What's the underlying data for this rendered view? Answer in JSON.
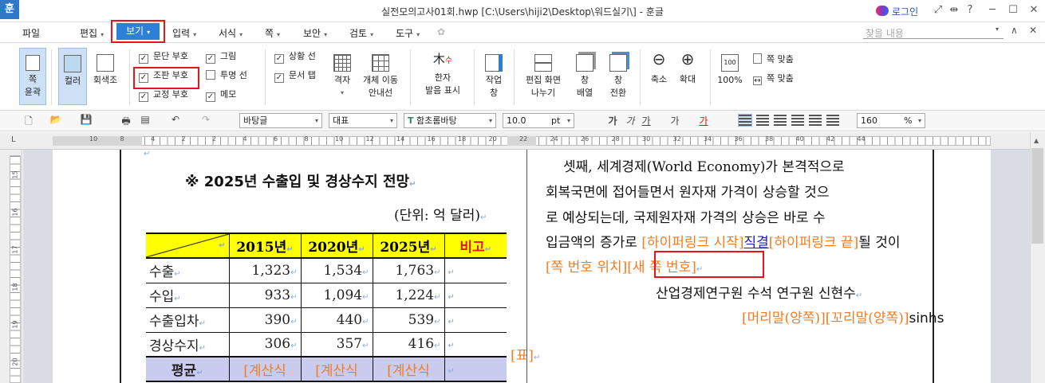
{
  "titlebar": {
    "app_icon": "훈",
    "title": "실전모의고사01회.hwp [C:\\Users\\hiji2\\Desktop\\워드실기\\] - 훈글",
    "login": "로그인",
    "icons": [
      "fullscreen-icon",
      "split-icon",
      "help-icon",
      "minimize-icon",
      "maximize-icon",
      "close-icon"
    ]
  },
  "menubar": {
    "items": [
      "파일",
      "편집",
      "보기",
      "입력",
      "서식",
      "쪽",
      "보안",
      "검토",
      "도구"
    ],
    "active": "보기",
    "find_placeholder": "찾을 내용"
  },
  "ribbon": {
    "page_outline": [
      "쪽",
      "윤곽"
    ],
    "color": "컬러",
    "grayscale": "회색조",
    "checks_col1": [
      {
        "label": "문단 부호",
        "checked": true
      },
      {
        "label": "조판 부호",
        "checked": true
      },
      {
        "label": "교정 부호",
        "checked": true
      }
    ],
    "checks_col2": [
      {
        "label": "그림",
        "checked": true
      },
      {
        "label": "투명 선",
        "checked": false
      },
      {
        "label": "메모",
        "checked": true
      }
    ],
    "checks_col3": [
      {
        "label": "상황 선",
        "checked": true
      },
      {
        "label": "문서 탭",
        "checked": true
      }
    ],
    "grid": "격자",
    "object_move": [
      "개체 이동",
      "안내선"
    ],
    "hanja": [
      "한자",
      "발음 표시"
    ],
    "work_window": [
      "작업",
      "창"
    ],
    "split": [
      "편집 화면",
      "나누기"
    ],
    "arrange": [
      "창",
      "배열"
    ],
    "switch": [
      "창",
      "전환"
    ],
    "zoom_out": "축소",
    "zoom_in": "확대",
    "zoom_100": "100%",
    "fit_page": "쪽 맞춤",
    "fit_width": "쪽 맞춤"
  },
  "format": {
    "style": "바탕글",
    "font_set": "대표",
    "font": "함초롬바탕",
    "size": "10.0",
    "size_unit": "pt",
    "bold": "가",
    "italic": "가",
    "underline": "가",
    "strike": "가",
    "color": "가",
    "line_spacing": "160",
    "line_unit": "%"
  },
  "ruler": {
    "h_labels": [
      "10",
      "8",
      "4",
      "2",
      "2",
      "4",
      "6",
      "8",
      "10",
      "12",
      "14",
      "16",
      "18",
      "20",
      "22",
      "24",
      "26",
      "28",
      "30",
      "32",
      "34",
      "36",
      "38",
      "40",
      "42",
      "44"
    ],
    "v_labels": [
      "15",
      "16",
      "17",
      "18",
      "19",
      "20"
    ]
  },
  "doc": {
    "left": {
      "title": "※ 2025년 수출입 및 경상수지 전망",
      "unit": "(단위: 억 달러)",
      "table": {
        "headers": [
          "",
          "2015년",
          "2020년",
          "2025년",
          "비고"
        ],
        "rows": [
          [
            "수출",
            "1,323",
            "1,534",
            "1,763",
            ""
          ],
          [
            "수입",
            "933",
            "1,094",
            "1,224",
            ""
          ],
          [
            "수출입차",
            "390",
            "440",
            "539",
            ""
          ],
          [
            "경상수지",
            "306",
            "357",
            "416",
            ""
          ]
        ],
        "footer": [
          "평균",
          "[계산식",
          "[계산식",
          "[계산식",
          ""
        ]
      },
      "table_mark": "[표]"
    },
    "right": {
      "line1": "셋째, 세계경제(World Economy)가 본격적으로",
      "line2": "회복국면에 접어들면서 원자재 가격이 상승할 것으",
      "line3": "로 예상되는데, 국제원자재 가격의 상승은 바로 수",
      "line4_pre": "입금액의 증가로",
      "hyper_start": "[하이퍼링크 시작]",
      "hyper_text": "직결",
      "hyper_end": "[하이퍼링크 끝]",
      "line4_post": "될 것이",
      "page_num_pos": "[쪽 번호 위치]",
      "new_page_num": "[새 쪽 번호]",
      "author": "산업경제연구원 수석 연구원 신현수",
      "header_footer": "[머리말(양쪽)][꼬리말(양쪽)]",
      "trail": "sinhs"
    }
  }
}
